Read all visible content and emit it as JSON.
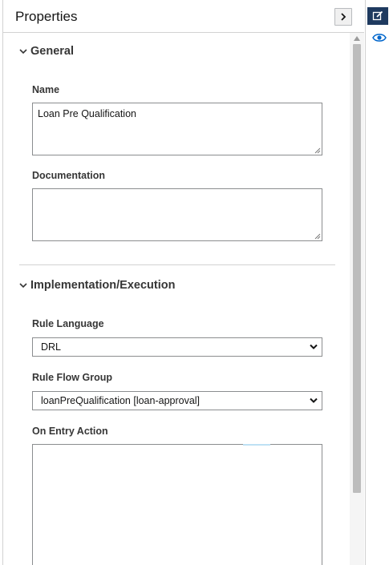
{
  "panel": {
    "title": "Properties"
  },
  "sections": {
    "general": {
      "title": "General",
      "name_label": "Name",
      "name_value": "Loan Pre Qualification",
      "documentation_label": "Documentation",
      "documentation_value": ""
    },
    "implementation": {
      "title": "Implementation/Execution",
      "rule_language_label": "Rule Language",
      "rule_language_value": "DRL",
      "rule_flow_group_label": "Rule Flow Group",
      "rule_flow_group_value": "loanPreQualification [loan-approval]",
      "on_entry_label": "On Entry Action",
      "on_entry_value": ""
    }
  },
  "colors": {
    "accent": "#1e3a5f",
    "link": "#0066cc"
  },
  "icons": {
    "collapse": "chevron-right-icon",
    "edit": "edit-icon",
    "preview": "eye-icon",
    "section": "chevron-down-icon"
  }
}
